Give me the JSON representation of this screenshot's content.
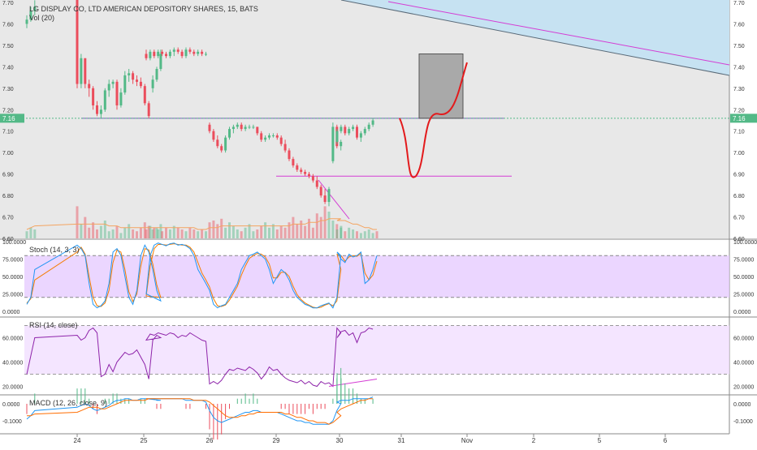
{
  "header": {
    "title": "LG DISPLAY CO, LTD AMERICAN DEPOSITORY SHARES, 15, BATS",
    "vol_label": "Vol (20)"
  },
  "price_axis": {
    "ticks": [
      "7.70",
      "7.60",
      "7.50",
      "7.40",
      "7.30",
      "7.20",
      "7.10",
      "7.00",
      "6.90",
      "6.80",
      "6.70",
      "6.60"
    ],
    "last_price": "7.16"
  },
  "x_axis": {
    "labels": [
      "24",
      "25",
      "26",
      "29",
      "30",
      "31",
      "Nov",
      "2",
      "5",
      "6"
    ]
  },
  "stoch": {
    "label": "Stoch (14, 3, 3)",
    "ticks": [
      "100.0000",
      "75.0000",
      "50.0000",
      "25.0000",
      "0.0000"
    ]
  },
  "rsi": {
    "label": "RSI (14, close)",
    "ticks": [
      "60.0000",
      "40.0000",
      "20.0000"
    ]
  },
  "macd": {
    "label": "MACD (12, 26, close, 9)",
    "ticks": [
      "0.0000",
      "-0.1000"
    ]
  },
  "colors": {
    "up": "#53b987",
    "down": "#eb4d5c",
    "drawing": "#d43dd4",
    "projection": "#e31a1c",
    "channel_fill": "#c6e2f2",
    "indicator_band": "#e4c8ff",
    "macd_line": "#2196f3",
    "macd_signal": "#ff6d00",
    "gray_box": "#9e9e9e",
    "hline": "#7e57c2"
  },
  "chart_data": {
    "type": "candlestick",
    "ylim": [
      6.58,
      7.72
    ],
    "session_markers": [
      "24",
      "25",
      "26",
      "29",
      "30",
      "31"
    ],
    "candles": [
      {
        "o": 7.6,
        "h": 7.64,
        "l": 7.58,
        "c": 7.62
      },
      {
        "o": 7.62,
        "h": 7.68,
        "l": 7.61,
        "c": 7.66
      },
      {
        "o": 7.66,
        "h": 7.71,
        "l": 7.64,
        "c": 7.68
      },
      {
        "o": 7.72,
        "h": 7.72,
        "l": 7.3,
        "c": 7.32
      },
      {
        "o": 7.32,
        "h": 7.46,
        "l": 7.3,
        "c": 7.44
      },
      {
        "o": 7.44,
        "h": 7.44,
        "l": 7.3,
        "c": 7.32
      },
      {
        "o": 7.32,
        "h": 7.34,
        "l": 7.26,
        "c": 7.3
      },
      {
        "o": 7.3,
        "h": 7.31,
        "l": 7.2,
        "c": 7.22
      },
      {
        "o": 7.22,
        "h": 7.24,
        "l": 7.17,
        "c": 7.18
      },
      {
        "o": 7.18,
        "h": 7.22,
        "l": 7.16,
        "c": 7.2
      },
      {
        "o": 7.2,
        "h": 7.3,
        "l": 7.19,
        "c": 7.29
      },
      {
        "o": 7.29,
        "h": 7.34,
        "l": 7.26,
        "c": 7.32
      },
      {
        "o": 7.32,
        "h": 7.34,
        "l": 7.3,
        "c": 7.33
      },
      {
        "o": 7.33,
        "h": 7.34,
        "l": 7.2,
        "c": 7.22
      },
      {
        "o": 7.22,
        "h": 7.3,
        "l": 7.21,
        "c": 7.28
      },
      {
        "o": 7.28,
        "h": 7.38,
        "l": 7.27,
        "c": 7.36
      },
      {
        "o": 7.36,
        "h": 7.39,
        "l": 7.33,
        "c": 7.37
      },
      {
        "o": 7.37,
        "h": 7.38,
        "l": 7.32,
        "c": 7.34
      },
      {
        "o": 7.34,
        "h": 7.36,
        "l": 7.31,
        "c": 7.33
      },
      {
        "o": 7.33,
        "h": 7.35,
        "l": 7.3,
        "c": 7.31
      },
      {
        "o": 7.31,
        "h": 7.32,
        "l": 7.22,
        "c": 7.23
      },
      {
        "o": 7.23,
        "h": 7.24,
        "l": 7.16,
        "c": 7.17
      },
      {
        "o": 7.3,
        "h": 7.36,
        "l": 7.28,
        "c": 7.34
      },
      {
        "o": 7.34,
        "h": 7.4,
        "l": 7.33,
        "c": 7.39
      },
      {
        "o": 7.39,
        "h": 7.48,
        "l": 7.38,
        "c": 7.46
      },
      {
        "o": 7.46,
        "h": 7.48,
        "l": 7.43,
        "c": 7.44
      },
      {
        "o": 7.44,
        "h": 7.48,
        "l": 7.43,
        "c": 7.47
      },
      {
        "o": 7.47,
        "h": 7.48,
        "l": 7.44,
        "c": 7.45
      },
      {
        "o": 7.45,
        "h": 7.48,
        "l": 7.44,
        "c": 7.47
      },
      {
        "o": 7.47,
        "h": 7.48,
        "l": 7.45,
        "c": 7.46
      },
      {
        "o": 7.46,
        "h": 7.47,
        "l": 7.44,
        "c": 7.45
      },
      {
        "o": 7.45,
        "h": 7.48,
        "l": 7.44,
        "c": 7.47
      },
      {
        "o": 7.47,
        "h": 7.49,
        "l": 7.45,
        "c": 7.48
      },
      {
        "o": 7.48,
        "h": 7.49,
        "l": 7.46,
        "c": 7.47
      },
      {
        "o": 7.47,
        "h": 7.48,
        "l": 7.44,
        "c": 7.45
      },
      {
        "o": 7.45,
        "h": 7.49,
        "l": 7.44,
        "c": 7.48
      },
      {
        "o": 7.48,
        "h": 7.49,
        "l": 7.46,
        "c": 7.47
      },
      {
        "o": 7.47,
        "h": 7.48,
        "l": 7.45,
        "c": 7.46
      },
      {
        "o": 7.46,
        "h": 7.48,
        "l": 7.45,
        "c": 7.47
      },
      {
        "o": 7.47,
        "h": 7.48,
        "l": 7.45,
        "c": 7.46
      },
      {
        "o": 7.46,
        "h": 7.47,
        "l": 7.45,
        "c": 7.46
      },
      {
        "o": 7.13,
        "h": 7.14,
        "l": 7.09,
        "c": 7.1
      },
      {
        "o": 7.1,
        "h": 7.11,
        "l": 7.05,
        "c": 7.06
      },
      {
        "o": 7.06,
        "h": 7.08,
        "l": 7.02,
        "c": 7.03
      },
      {
        "o": 7.03,
        "h": 7.04,
        "l": 7.0,
        "c": 7.01
      },
      {
        "o": 7.01,
        "h": 7.08,
        "l": 7.0,
        "c": 7.07
      },
      {
        "o": 7.07,
        "h": 7.12,
        "l": 7.06,
        "c": 7.11
      },
      {
        "o": 7.11,
        "h": 7.13,
        "l": 7.09,
        "c": 7.12
      },
      {
        "o": 7.12,
        "h": 7.14,
        "l": 7.11,
        "c": 7.13
      },
      {
        "o": 7.13,
        "h": 7.14,
        "l": 7.1,
        "c": 7.11
      },
      {
        "o": 7.11,
        "h": 7.13,
        "l": 7.1,
        "c": 7.12
      },
      {
        "o": 7.12,
        "h": 7.13,
        "l": 7.11,
        "c": 7.12
      },
      {
        "o": 7.12,
        "h": 7.13,
        "l": 7.11,
        "c": 7.12
      },
      {
        "o": 7.12,
        "h": 7.12,
        "l": 7.08,
        "c": 7.09
      },
      {
        "o": 7.09,
        "h": 7.1,
        "l": 7.05,
        "c": 7.06
      },
      {
        "o": 7.06,
        "h": 7.08,
        "l": 7.05,
        "c": 7.07
      },
      {
        "o": 7.07,
        "h": 7.09,
        "l": 7.06,
        "c": 7.08
      },
      {
        "o": 7.08,
        "h": 7.09,
        "l": 7.07,
        "c": 7.08
      },
      {
        "o": 7.08,
        "h": 7.09,
        "l": 7.06,
        "c": 7.07
      },
      {
        "o": 7.07,
        "h": 7.08,
        "l": 7.03,
        "c": 7.04
      },
      {
        "o": 7.04,
        "h": 7.06,
        "l": 7.0,
        "c": 7.01
      },
      {
        "o": 7.01,
        "h": 7.02,
        "l": 6.96,
        "c": 6.97
      },
      {
        "o": 6.97,
        "h": 6.98,
        "l": 6.93,
        "c": 6.94
      },
      {
        "o": 6.94,
        "h": 6.95,
        "l": 6.91,
        "c": 6.92
      },
      {
        "o": 6.92,
        "h": 6.93,
        "l": 6.9,
        "c": 6.91
      },
      {
        "o": 6.91,
        "h": 6.92,
        "l": 6.89,
        "c": 6.9
      },
      {
        "o": 6.9,
        "h": 6.91,
        "l": 6.88,
        "c": 6.89
      },
      {
        "o": 6.89,
        "h": 6.9,
        "l": 6.86,
        "c": 6.87
      },
      {
        "o": 6.87,
        "h": 6.89,
        "l": 6.83,
        "c": 6.84
      },
      {
        "o": 6.84,
        "h": 6.85,
        "l": 6.79,
        "c": 6.8
      },
      {
        "o": 6.8,
        "h": 6.83,
        "l": 6.76,
        "c": 6.77
      },
      {
        "o": 6.77,
        "h": 6.84,
        "l": 6.75,
        "c": 6.83
      },
      {
        "o": 6.96,
        "h": 7.14,
        "l": 6.95,
        "c": 7.12
      },
      {
        "o": 7.12,
        "h": 7.13,
        "l": 7.02,
        "c": 7.03
      },
      {
        "o": 7.03,
        "h": 7.06,
        "l": 7.01,
        "c": 7.05
      },
      {
        "o": 7.05,
        "h": 7.11,
        "l": 7.04,
        "c": 7.1
      },
      {
        "o": 7.1,
        "h": 7.13,
        "l": 7.09,
        "c": 7.12
      },
      {
        "o": 7.12,
        "h": 7.13,
        "l": 7.08,
        "c": 7.09
      },
      {
        "o": 7.09,
        "h": 7.12,
        "l": 7.08,
        "c": 7.11
      },
      {
        "o": 7.11,
        "h": 7.13,
        "l": 7.1,
        "c": 7.12
      },
      {
        "o": 7.12,
        "h": 7.13,
        "l": 7.06,
        "c": 7.07
      },
      {
        "o": 7.07,
        "h": 7.1,
        "l": 7.05,
        "c": 7.09
      },
      {
        "o": 7.09,
        "h": 7.12,
        "l": 7.08,
        "c": 7.11
      },
      {
        "o": 7.11,
        "h": 7.14,
        "l": 7.1,
        "c": 7.13
      },
      {
        "o": 7.13,
        "h": 7.16,
        "l": 7.12,
        "c": 7.15
      }
    ],
    "volume": [
      4,
      6,
      5,
      18,
      8,
      12,
      6,
      9,
      5,
      7,
      10,
      4,
      5,
      7,
      3,
      6,
      8,
      5,
      4,
      6,
      9,
      7,
      5,
      6,
      8,
      5,
      7,
      6,
      5,
      4,
      6,
      5,
      7,
      6,
      5,
      4,
      6,
      5,
      4,
      5,
      4,
      9,
      10,
      8,
      11,
      6,
      9,
      7,
      5,
      4,
      6,
      8,
      4,
      5,
      7,
      9,
      6,
      8,
      5,
      7,
      6,
      9,
      12,
      8,
      10,
      7,
      11,
      6,
      14,
      12,
      18,
      15,
      10,
      8,
      6,
      5,
      7,
      4,
      6,
      5,
      4,
      3,
      4,
      5,
      3,
      4
    ],
    "volume_ma": [
      5,
      6,
      7,
      8,
      8,
      8,
      8,
      8,
      8,
      8,
      8,
      7,
      7,
      7,
      6,
      6,
      6,
      6,
      6,
      6,
      6,
      6,
      6,
      6,
      6,
      6,
      6,
      6,
      6,
      6,
      6,
      6,
      6,
      6,
      6,
      6,
      6,
      6,
      5,
      5,
      5,
      6,
      6,
      6,
      7,
      7,
      7,
      7,
      7,
      7,
      7,
      7,
      7,
      7,
      7,
      7,
      7,
      7,
      7,
      7,
      7,
      7,
      8,
      8,
      8,
      8,
      9,
      9,
      9,
      10,
      10,
      11,
      11,
      11,
      11,
      10,
      10,
      10,
      9,
      8,
      8,
      7,
      6,
      6,
      5,
      5
    ],
    "stoch_k": [
      10,
      20,
      60,
      95,
      90,
      80,
      40,
      10,
      5,
      8,
      15,
      40,
      85,
      90,
      80,
      50,
      20,
      10,
      30,
      80,
      95,
      85,
      60,
      30,
      15,
      25,
      80,
      95,
      98,
      96,
      94,
      97,
      98,
      95,
      96,
      94,
      90,
      80,
      60,
      50,
      40,
      30,
      10,
      5,
      8,
      10,
      20,
      30,
      40,
      60,
      70,
      80,
      82,
      85,
      80,
      75,
      60,
      40,
      50,
      60,
      55,
      45,
      30,
      20,
      15,
      10,
      8,
      5,
      5,
      8,
      10,
      12,
      5,
      20,
      80,
      85,
      75,
      70,
      82,
      78,
      80,
      85,
      40,
      45,
      60,
      80,
      95
    ],
    "stoch_d": [
      12,
      18,
      45,
      85,
      92,
      82,
      50,
      20,
      8,
      7,
      12,
      30,
      70,
      88,
      85,
      60,
      28,
      14,
      25,
      65,
      90,
      88,
      68,
      38,
      20,
      22,
      65,
      90,
      96,
      96,
      95,
      96,
      97,
      96,
      95,
      95,
      92,
      85,
      70,
      55,
      45,
      35,
      18,
      8,
      7,
      9,
      16,
      26,
      36,
      52,
      65,
      76,
      80,
      83,
      82,
      78,
      68,
      48,
      48,
      56,
      56,
      50,
      36,
      24,
      17,
      12,
      9,
      6,
      5,
      6,
      9,
      11,
      8,
      15,
      60,
      82,
      80,
      72,
      78,
      80,
      79,
      83,
      55,
      45,
      52,
      72,
      90
    ],
    "stoch_bands": [
      80,
      20
    ],
    "rsi": [
      30,
      45,
      60,
      62,
      58,
      60,
      66,
      68,
      64,
      28,
      30,
      38,
      32,
      40,
      44,
      48,
      46,
      47,
      50,
      44,
      38,
      26,
      58,
      62,
      60,
      58,
      63,
      62,
      64,
      63,
      62,
      64,
      63,
      60,
      62,
      61,
      64,
      62,
      60,
      58,
      57,
      22,
      24,
      22,
      25,
      30,
      34,
      33,
      35,
      34,
      33,
      36,
      34,
      31,
      26,
      30,
      36,
      33,
      34,
      30,
      27,
      25,
      24,
      23,
      25,
      22,
      24,
      21,
      20,
      24,
      22,
      23,
      20,
      68,
      64,
      60,
      65,
      66,
      62,
      64,
      56,
      64,
      65,
      68,
      67
    ],
    "rsi_bands": [
      70,
      30
    ],
    "rsi_trendline": [
      [
        71,
        20
      ],
      [
        85,
        26
      ]
    ],
    "macd_line": [
      -0.09,
      -0.07,
      -0.04,
      -0.02,
      -0.01,
      0,
      -0.01,
      -0.03,
      -0.04,
      -0.03,
      -0.02,
      -0.01,
      0.01,
      0.02,
      0.02,
      0.03,
      0.03,
      0.02,
      0.02,
      0.03,
      0.03,
      0.03,
      0.03,
      0.02,
      0.02,
      0.03,
      0.03,
      0.03,
      0.03,
      0.03,
      0.03,
      0.03,
      0.03,
      0.03,
      0.03,
      0.02,
      0.02,
      0.02,
      0.02,
      0.02,
      0.01,
      -0.04,
      -0.08,
      -0.1,
      -0.11,
      -0.1,
      -0.09,
      -0.08,
      -0.07,
      -0.06,
      -0.05,
      -0.05,
      -0.04,
      -0.04,
      -0.05,
      -0.05,
      -0.05,
      -0.05,
      -0.05,
      -0.06,
      -0.07,
      -0.08,
      -0.09,
      -0.1,
      -0.1,
      -0.11,
      -0.11,
      -0.12,
      -0.12,
      -0.12,
      -0.12,
      -0.12,
      -0.1,
      -0.04,
      0,
      0.01,
      0.02,
      0.02,
      0.02,
      0.03,
      0.03,
      0.03,
      0.03,
      0.03,
      0.04
    ],
    "macd_signal": [
      -0.07,
      -0.07,
      -0.06,
      -0.05,
      -0.04,
      -0.03,
      -0.02,
      -0.02,
      -0.02,
      -0.03,
      -0.03,
      -0.02,
      -0.01,
      0,
      0.01,
      0.02,
      0.02,
      0.02,
      0.02,
      0.02,
      0.02,
      0.03,
      0.03,
      0.03,
      0.03,
      0.03,
      0.03,
      0.03,
      0.03,
      0.03,
      0.03,
      0.03,
      0.03,
      0.03,
      0.03,
      0.03,
      0.03,
      0.02,
      0.02,
      0.02,
      0.02,
      0.01,
      -0.01,
      -0.03,
      -0.05,
      -0.07,
      -0.08,
      -0.08,
      -0.08,
      -0.07,
      -0.07,
      -0.06,
      -0.06,
      -0.05,
      -0.05,
      -0.05,
      -0.05,
      -0.05,
      -0.05,
      -0.05,
      -0.06,
      -0.06,
      -0.07,
      -0.08,
      -0.08,
      -0.09,
      -0.1,
      -0.1,
      -0.11,
      -0.11,
      -0.11,
      -0.12,
      -0.11,
      -0.09,
      -0.07,
      -0.05,
      -0.03,
      -0.02,
      -0.01,
      0,
      0.01,
      0.02,
      0.02,
      0.03,
      0.03
    ],
    "levels": {
      "resistance_line": 7.16,
      "support_line": 6.89
    },
    "projection_path": [
      [
        7.16,
        7.16
      ],
      [
        6.89,
        6.9
      ],
      [
        7.16,
        7.18
      ],
      [
        7.42,
        7.43
      ]
    ]
  }
}
